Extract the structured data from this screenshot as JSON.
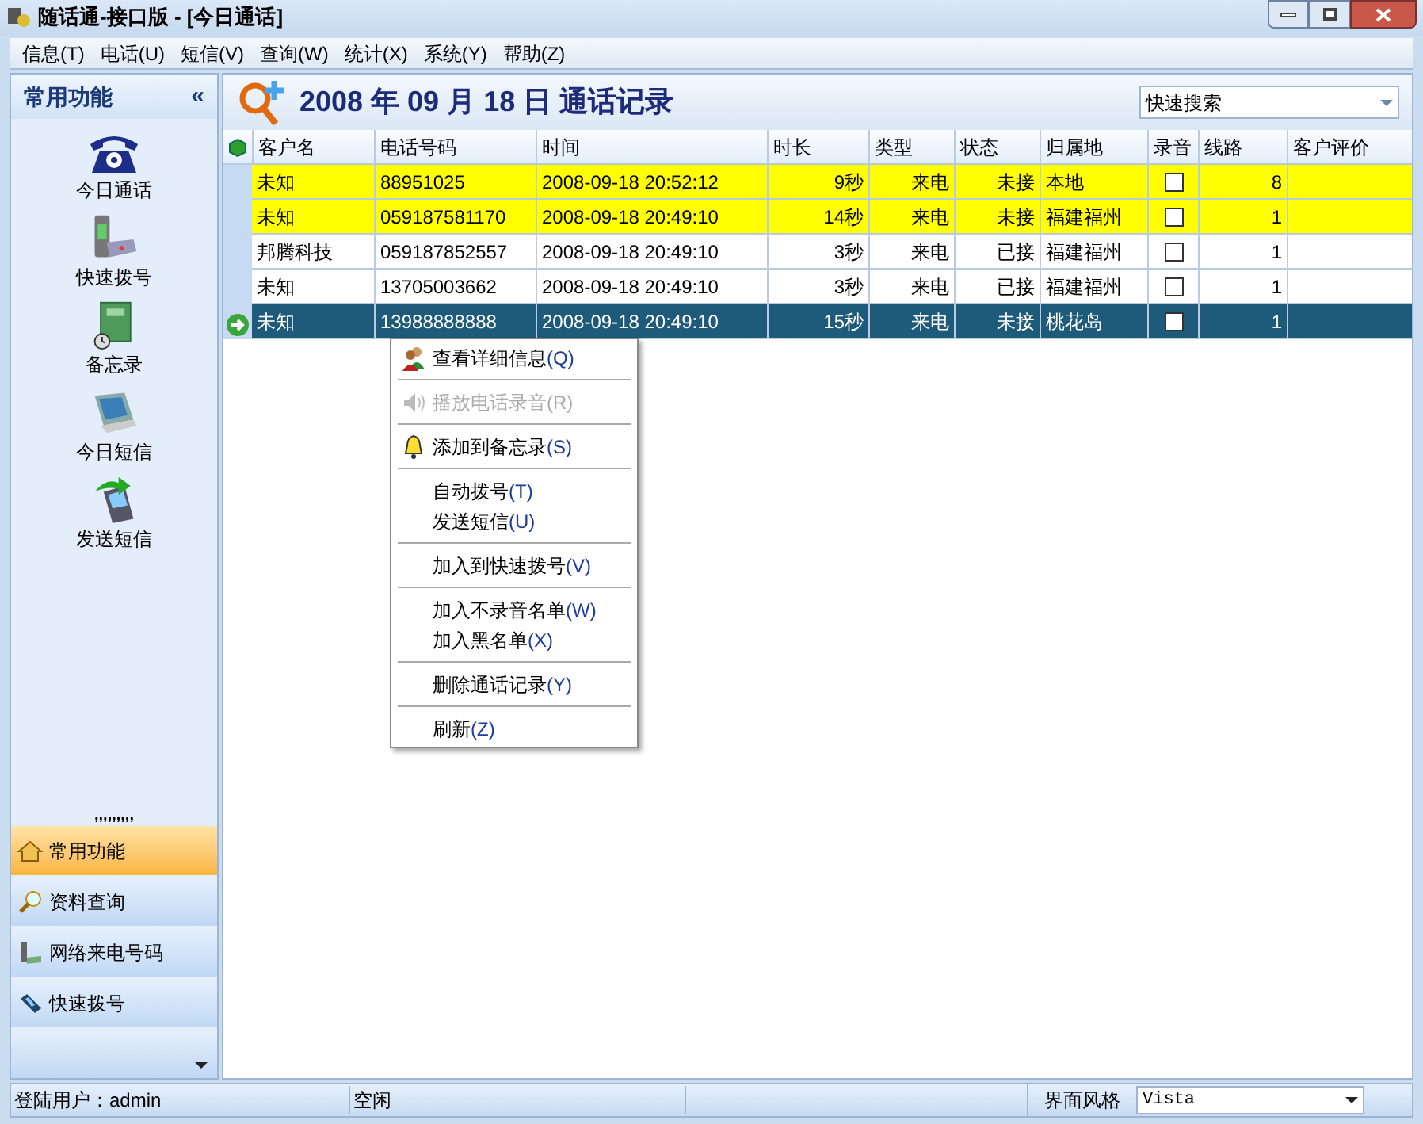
{
  "window": {
    "title": "随话通-接口版 - [今日通话]"
  },
  "menu_bar": [
    "信息(T)",
    "电话(U)",
    "短信(V)",
    "查询(W)",
    "统计(X)",
    "系统(Y)",
    "帮助(Z)"
  ],
  "sidebar": {
    "title": "常用功能",
    "collapse": "«",
    "items": [
      {
        "label": "今日通话",
        "kind": "phone"
      },
      {
        "label": "快速拨号",
        "kind": "dialer"
      },
      {
        "label": "备忘录",
        "kind": "memo"
      },
      {
        "label": "今日短信",
        "kind": "sms"
      },
      {
        "label": "发送短信",
        "kind": "send"
      }
    ],
    "grip": ",,,,,,,,,",
    "nav": [
      {
        "label": "常用功能",
        "kind": "home",
        "selected": true
      },
      {
        "label": "资料查询",
        "kind": "search",
        "selected": false
      },
      {
        "label": "网络来电号码",
        "kind": "net",
        "selected": false
      },
      {
        "label": "快速拨号",
        "kind": "dial",
        "selected": false
      }
    ]
  },
  "header": {
    "title": "2008 年 09 月 18 日 通话记录",
    "search": {
      "placeholder": "快速搜索"
    }
  },
  "table": {
    "columns": [
      "客户名",
      "电话号码",
      "时间",
      "时长",
      "类型",
      "状态",
      "归属地",
      "录音",
      "线路",
      "客户评价"
    ],
    "rows": [
      {
        "name": "未知",
        "phone": "88951025",
        "time": "2008-09-18 20:52:12",
        "duration": "9秒",
        "type": "来电",
        "status": "未接",
        "location": "本地",
        "recorded": false,
        "line": "8",
        "highlighted": true,
        "selected": false
      },
      {
        "name": "未知",
        "phone": "059187581170",
        "time": "2008-09-18 20:49:10",
        "duration": "14秒",
        "type": "来电",
        "status": "未接",
        "location": "福建福州",
        "recorded": false,
        "line": "1",
        "highlighted": true,
        "selected": false
      },
      {
        "name": "邦腾科技",
        "phone": "059187852557",
        "time": "2008-09-18 20:49:10",
        "duration": "3秒",
        "type": "来电",
        "status": "已接",
        "location": "福建福州",
        "recorded": false,
        "line": "1",
        "highlighted": false,
        "selected": false
      },
      {
        "name": "未知",
        "phone": "13705003662",
        "time": "2008-09-18 20:49:10",
        "duration": "3秒",
        "type": "来电",
        "status": "已接",
        "location": "福建福州",
        "recorded": false,
        "line": "1",
        "highlighted": false,
        "selected": false
      },
      {
        "name": "未知",
        "phone": "13988888888",
        "time": "2008-09-18 20:49:10",
        "duration": "15秒",
        "type": "来电",
        "status": "未接",
        "location": "桃花岛",
        "recorded": false,
        "line": "1",
        "highlighted": false,
        "selected": true
      }
    ]
  },
  "context_menu": [
    {
      "kind": "item",
      "label": "查看详细信息",
      "key": "(Q)",
      "disabled": false
    },
    {
      "kind": "separator"
    },
    {
      "kind": "item",
      "label": "播放电话录音",
      "key": "(R)",
      "disabled": true
    },
    {
      "kind": "separator"
    },
    {
      "kind": "item",
      "label": "添加到备忘录",
      "key": "(S)",
      "disabled": false
    },
    {
      "kind": "separator"
    },
    {
      "kind": "item",
      "label": "自动拨号",
      "key": "(T)",
      "disabled": false
    },
    {
      "kind": "item",
      "label": "发送短信",
      "key": "(U)",
      "disabled": false
    },
    {
      "kind": "separator"
    },
    {
      "kind": "item",
      "label": "加入到快速拨号",
      "key": "(V)",
      "disabled": false
    },
    {
      "kind": "separator"
    },
    {
      "kind": "item",
      "label": "加入不录音名单",
      "key": "(W)",
      "disabled": false
    },
    {
      "kind": "item",
      "label": "加入黑名单",
      "key": "(X)",
      "disabled": false
    },
    {
      "kind": "separator"
    },
    {
      "kind": "item",
      "label": "删除通话记录",
      "key": "(Y)",
      "disabled": false
    },
    {
      "kind": "separator"
    },
    {
      "kind": "item",
      "label": "刷新",
      "key": "(Z)",
      "disabled": false
    }
  ],
  "status_bar": {
    "user": "登陆用户：admin",
    "state": "空闲",
    "theme_label": "界面风格",
    "theme_value": "Vista"
  }
}
